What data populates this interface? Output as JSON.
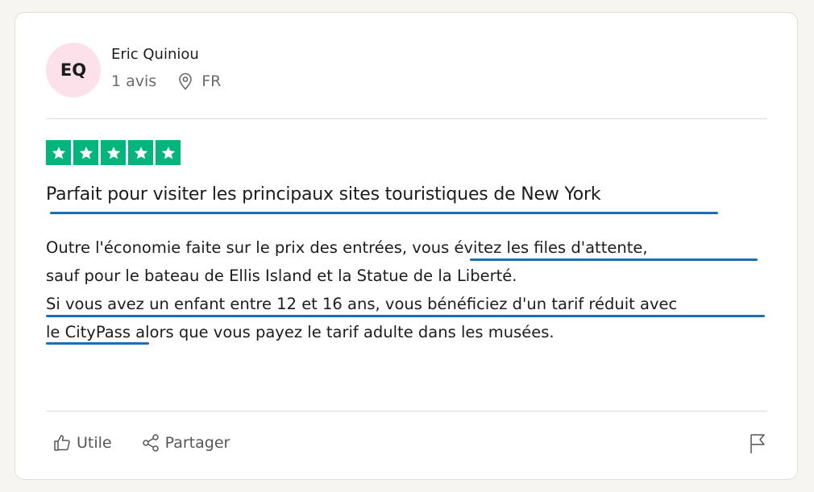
{
  "reviewer": {
    "initials": "EQ",
    "name": "Eric Quiniou",
    "review_count": "1 avis",
    "country": "FR",
    "location_icon": "location-pin-icon",
    "avatar_color": "#fde1ea"
  },
  "rating": {
    "stars": 5,
    "max_stars": 5,
    "star_color": "#00b67a",
    "star_icon": "star-icon"
  },
  "review": {
    "title": "Parfait pour visiter les principaux sites touristiques de New York",
    "body_lines": [
      "Outre l'économie faite sur le prix des entrées, vous évitez les files d'attente,",
      "sauf pour le bateau de Ellis Island et la Statue de la Liberté.",
      "Si vous avez un enfant entre 12 et 16 ans, vous bénéficiez d'un tarif réduit avec",
      "le CityPass alors que vous payez le tarif adulte dans les musées."
    ],
    "highlight_color": "#1a6fb5"
  },
  "actions": {
    "useful_label": "Utile",
    "useful_icon": "thumbs-up-icon",
    "share_label": "Partager",
    "share_icon": "share-icon",
    "report_icon": "flag-icon"
  }
}
